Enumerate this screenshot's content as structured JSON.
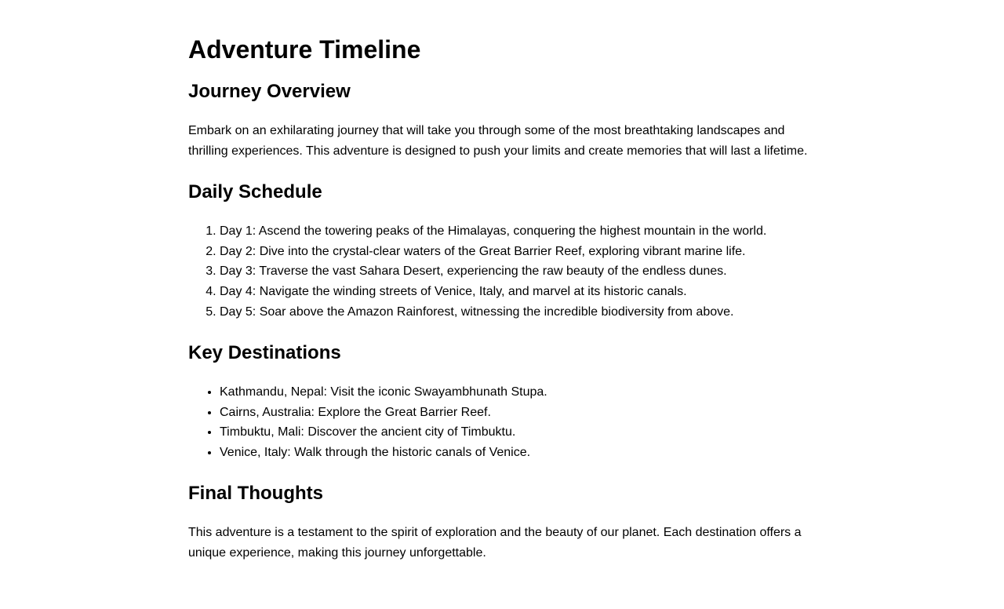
{
  "title": "Adventure Timeline",
  "overview": {
    "heading": "Journey Overview",
    "text": "Embark on an exhilarating journey that will take you through some of the most breathtaking landscapes and thrilling experiences. This adventure is designed to push your limits and create memories that will last a lifetime."
  },
  "schedule": {
    "heading": "Daily Schedule",
    "items": [
      "Day 1: Ascend the towering peaks of the Himalayas, conquering the highest mountain in the world.",
      "Day 2: Dive into the crystal-clear waters of the Great Barrier Reef, exploring vibrant marine life.",
      "Day 3: Traverse the vast Sahara Desert, experiencing the raw beauty of the endless dunes.",
      "Day 4: Navigate the winding streets of Venice, Italy, and marvel at its historic canals.",
      "Day 5: Soar above the Amazon Rainforest, witnessing the incredible biodiversity from above."
    ]
  },
  "destinations": {
    "heading": "Key Destinations",
    "items": [
      "Kathmandu, Nepal: Visit the iconic Swayambhunath Stupa.",
      "Cairns, Australia: Explore the Great Barrier Reef.",
      "Timbuktu, Mali: Discover the ancient city of Timbuktu.",
      "Venice, Italy: Walk through the historic canals of Venice."
    ]
  },
  "final": {
    "heading": "Final Thoughts",
    "text": "This adventure is a testament to the spirit of exploration and the beauty of our planet. Each destination offers a unique experience, making this journey unforgettable."
  }
}
